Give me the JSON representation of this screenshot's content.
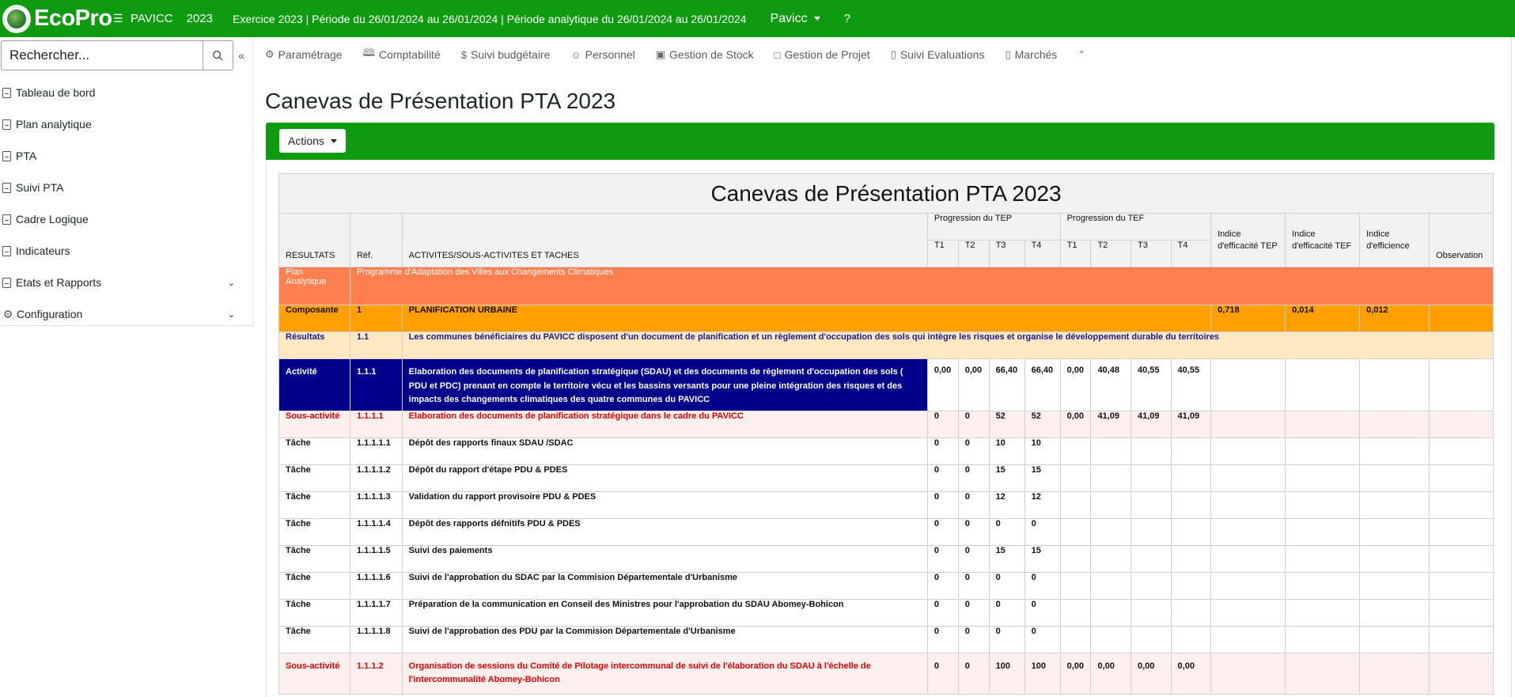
{
  "topbar": {
    "logo_text": "EcoPro",
    "app_name": "PAVICC",
    "year": "2023",
    "period": "Exercice 2023 | Période du 26/01/2024 au 26/01/2024 | Période analytique du 26/01/2024 au 26/01/2024",
    "user": "Pavicc",
    "help": "?"
  },
  "sidebar": {
    "search_placeholder": "Rechercher...",
    "collapse_glyph": "«",
    "items": [
      {
        "label": "Tableau de bord",
        "icon": "document-icon"
      },
      {
        "label": "Plan analytique",
        "icon": "document-icon"
      },
      {
        "label": "PTA",
        "icon": "document-icon"
      },
      {
        "label": "Suivi PTA",
        "icon": "document-icon"
      },
      {
        "label": "Cadre Logique",
        "icon": "document-icon"
      },
      {
        "label": "Indicateurs",
        "icon": "document-icon"
      },
      {
        "label": "Etats et Rapports",
        "icon": "document-icon",
        "has_chevron": true
      },
      {
        "label": "Configuration",
        "icon": "gear-icon",
        "has_chevron": true
      }
    ]
  },
  "modnav": [
    {
      "label": "Paramétrage",
      "icon": "gear-icon"
    },
    {
      "label": "Comptabilité",
      "icon": "book-icon"
    },
    {
      "label": "Suivi budgétaire",
      "icon": "dollar-icon"
    },
    {
      "label": "Personnel",
      "icon": "person-icon"
    },
    {
      "label": "Gestion de Stock",
      "icon": "truck-icon"
    },
    {
      "label": "Gestion de Projet",
      "icon": "folder-icon"
    },
    {
      "label": "Suivi Evaluations",
      "icon": "document-icon"
    },
    {
      "label": "Marchés",
      "icon": "document-icon"
    }
  ],
  "page": {
    "title": "Canevas de Présentation PTA 2023",
    "actions_label": "Actions"
  },
  "table": {
    "caption": "Canevas de Présentation PTA 2023",
    "headers": {
      "resultats": "RESULTATS",
      "ref": "Réf.",
      "activites": "ACTIVITES/SOUS-ACTIVITES ET TACHES",
      "prog_tep": "Progression du TEP",
      "prog_tef": "Progression du TEF",
      "quarters": [
        "T1",
        "T2",
        "T3",
        "T4"
      ],
      "indice_tep": "Indice d'efficacité TEP",
      "indice_tef": "Indice d'efficacité TEF",
      "indice_eff": "Indice d'efficience",
      "observation": "Observation"
    },
    "plan_row": {
      "type": "Plan Analytique",
      "label": "Programme d'Adaptation des Villes aux Changements Climatiques"
    },
    "composante_row": {
      "type": "Composante",
      "ref": "1",
      "label": "PLANIFICATION URBAINE",
      "indice_tep": "0,718",
      "indice_tef": "0,014",
      "indice_eff": "0,012"
    },
    "resultats_row": {
      "type": "Résultats",
      "ref": "1.1",
      "label": "Les communes bénéficiaires du PAVICC disposent d'un document de planification et un règlement d'occupation des sols qui intègre les risques et organise le développement durable du territoires"
    },
    "activite_row": {
      "type": "Activité",
      "ref": "1.1.1",
      "label": "Elaboration des documents de planification stratégique (SDAU) et des documents de règlement d'occupation des sols ( PDU et PDC) prenant en compte le territoire vécu et les bassins versants pour une pleine intégration des risques et des impacts des changements climatiques des quatre communes du PAVICC",
      "tep": [
        "0,00",
        "0,00",
        "66,40",
        "66,40"
      ],
      "tef": [
        "0,00",
        "40,48",
        "40,55",
        "40,55"
      ]
    },
    "sous_activite_1": {
      "type": "Sous-activité",
      "ref": "1.1.1.1",
      "label": "Elaboration des documents de planification stratégique dans le cadre du PAVICC",
      "tep": [
        "0",
        "0",
        "52",
        "52"
      ],
      "tef": [
        "0,00",
        "41,09",
        "41,09",
        "41,09"
      ]
    },
    "tasks": [
      {
        "type": "Tâche",
        "ref": "1.1.1.1.1",
        "label": "Dépôt des rapports finaux SDAU /SDAC",
        "tep": [
          "0",
          "0",
          "10",
          "10"
        ]
      },
      {
        "type": "Tâche",
        "ref": "1.1.1.1.2",
        "label": "Dépôt du rapport d'étape PDU & PDES",
        "tep": [
          "0",
          "0",
          "15",
          "15"
        ]
      },
      {
        "type": "Tâche",
        "ref": "1.1.1.1.3",
        "label": "Validation du rapport provisoire PDU & PDES",
        "tep": [
          "0",
          "0",
          "12",
          "12"
        ]
      },
      {
        "type": "Tâche",
        "ref": "1.1.1.1.4",
        "label": "Dépôt des rapports défnitifs PDU & PDES",
        "tep": [
          "0",
          "0",
          "0",
          "0"
        ]
      },
      {
        "type": "Tâche",
        "ref": "1.1.1.1.5",
        "label": "Suivi des paiements",
        "tep": [
          "0",
          "0",
          "15",
          "15"
        ]
      },
      {
        "type": "Tâche",
        "ref": "1.1.1.1.6",
        "label": "Suivi de l'approbation du SDAC par la Commision Départementale d'Urbanisme",
        "tep": [
          "0",
          "0",
          "0",
          "0"
        ]
      },
      {
        "type": "Tâche",
        "ref": "1.1.1.1.7",
        "label": "Préparation de la communication en Conseil des Ministres pour l'approbation du SDAU Abomey-Bohicon",
        "tep": [
          "0",
          "0",
          "0",
          "0"
        ]
      },
      {
        "type": "Tâche",
        "ref": "1.1.1.1.8",
        "label": "Suivi de l'approbation des PDU par la Commision Départementale d'Urbanisme",
        "tep": [
          "0",
          "0",
          "0",
          "0"
        ]
      }
    ],
    "sous_activite_2": {
      "type": "Sous-activité",
      "ref": "1.1.1.2",
      "label": "Organisation de sessions du Comité de Pilotage intercommunal de suivi de l'élaboration du SDAU à l'échelle de l'intercommunalité Abomey-Bohicon",
      "tep": [
        "0",
        "0",
        "100",
        "100"
      ],
      "tef": [
        "0,00",
        "0,00",
        "0,00",
        "0,00"
      ]
    }
  },
  "colors": {
    "brand_green": "#0f9b0f",
    "plan_row": "#ff7f50",
    "composante_row": "#ff9f00",
    "resultats_row": "#ffe8c2",
    "activite_dark": "#00008b",
    "sous_activite_text": "#e00000"
  }
}
